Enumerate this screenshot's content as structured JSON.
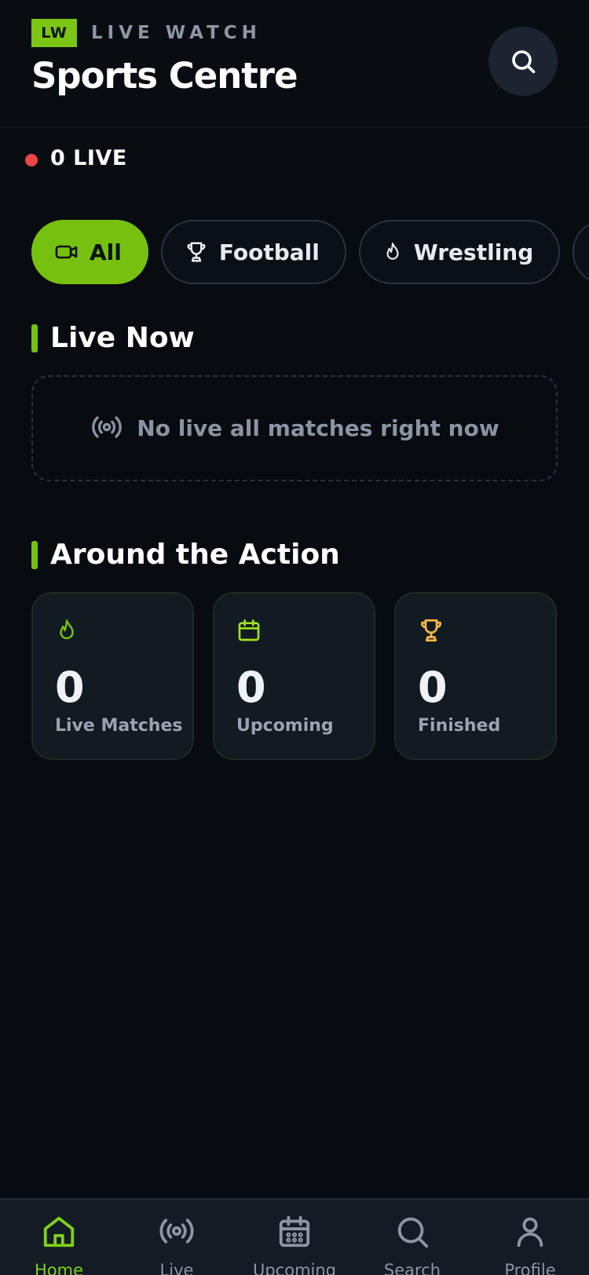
{
  "header": {
    "badge": "LW",
    "brand": "LIVE WATCH",
    "title": "Sports Centre"
  },
  "live_bar": {
    "count_label": "0 LIVE"
  },
  "chips": [
    {
      "label": "All",
      "icon": "video-icon",
      "active": true
    },
    {
      "label": "Football",
      "icon": "trophy-icon",
      "active": false
    },
    {
      "label": "Wrestling",
      "icon": "flame-icon",
      "active": false
    }
  ],
  "live_now": {
    "title": "Live Now",
    "empty_text": "No live all matches right now"
  },
  "around": {
    "title": "Around the Action",
    "stats": [
      {
        "value": "0",
        "label": "Live Matches",
        "icon": "flame-icon",
        "color": "#76c10f"
      },
      {
        "value": "0",
        "label": "Upcoming",
        "icon": "calendar-icon",
        "color": "#9ee21f"
      },
      {
        "value": "0",
        "label": "Finished",
        "icon": "trophy-icon",
        "color": "#f2b64a"
      }
    ]
  },
  "tabbar": [
    {
      "label": "Home",
      "icon": "home-icon",
      "active": true
    },
    {
      "label": "Live",
      "icon": "broadcast-icon",
      "active": false
    },
    {
      "label": "Upcoming",
      "icon": "calendar-icon",
      "active": false
    },
    {
      "label": "Search",
      "icon": "search-icon",
      "active": false
    },
    {
      "label": "Profile",
      "icon": "user-icon",
      "active": false
    }
  ],
  "colors": {
    "accent": "#76c10f",
    "live_dot": "#ef4545",
    "background": "#080b10"
  }
}
